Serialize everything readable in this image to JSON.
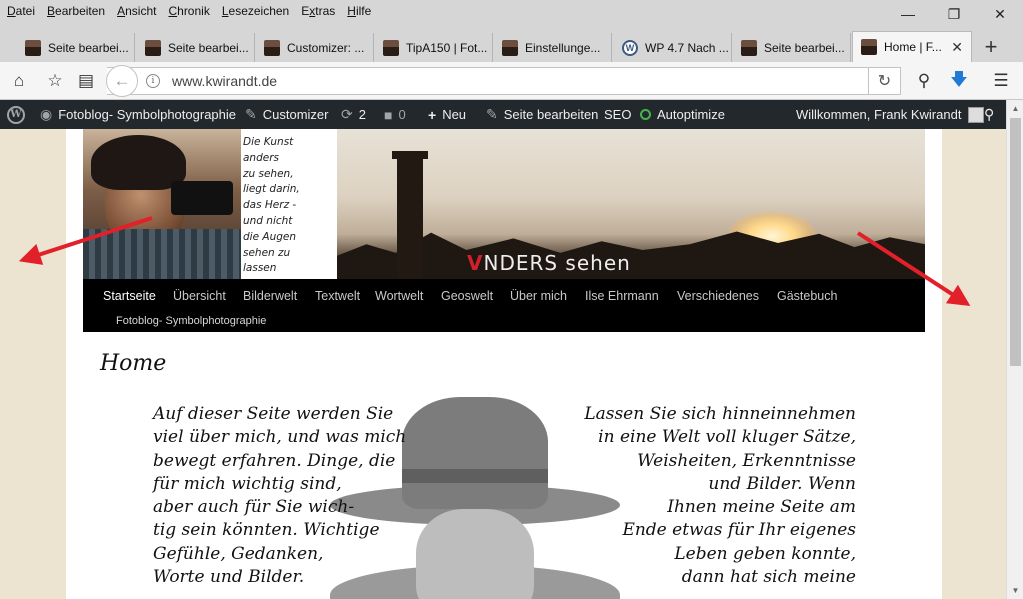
{
  "menubar": {
    "items": [
      {
        "pre": "",
        "key": "D",
        "post": "atei"
      },
      {
        "pre": "",
        "key": "B",
        "post": "earbeiten"
      },
      {
        "pre": "",
        "key": "A",
        "post": "nsicht"
      },
      {
        "pre": "",
        "key": "C",
        "post": "hronik"
      },
      {
        "pre": "",
        "key": "L",
        "post": "esezeichen"
      },
      {
        "pre": "E",
        "key": "x",
        "post": "tras"
      },
      {
        "pre": "",
        "key": "H",
        "post": "ilfe"
      }
    ]
  },
  "window": {
    "minimize_icon": "minimize-icon",
    "restore_icon": "restore-icon",
    "close_icon": "close-icon"
  },
  "tabs": [
    {
      "label": "Seite bearbei...",
      "favicon": "user-photo"
    },
    {
      "label": "Seite bearbei...",
      "favicon": "user-photo"
    },
    {
      "label": "Customizer: ...",
      "favicon": "user-photo"
    },
    {
      "label": "TipA150 | Fot...",
      "favicon": "user-photo"
    },
    {
      "label": "Einstellunge...",
      "favicon": "user-photo"
    },
    {
      "label": "WP 4.7 Nach ...",
      "favicon": "wordpress"
    },
    {
      "label": "Seite bearbei...",
      "favicon": "user-photo"
    },
    {
      "label": "Home | F...",
      "favicon": "user-photo",
      "active": true
    }
  ],
  "new_tab_label": "+",
  "navbar": {
    "url": "www.kwirandt.de",
    "info_glyph": "i"
  },
  "adminbar": {
    "site_name": "Fotoblog- Symbolphotographie",
    "customizer": "Customizer",
    "updates_count": "2",
    "comments_count": "0",
    "new_label": "Neu",
    "edit_page": "Seite bearbeiten",
    "seo": "SEO",
    "autoptimize": "Autoptimize",
    "greeting": "Willkommen, Frank Kwirandt"
  },
  "header": {
    "quote_lines": [
      "Die Kunst",
      "anders",
      "zu sehen,",
      "liegt darin,",
      "das Herz -",
      "und nicht",
      "die Augen",
      "sehen zu",
      "lassen"
    ],
    "brand_v": "V",
    "brand_rest": "NDERS sehen"
  },
  "nav": {
    "items": [
      "Startseite",
      "Übersicht",
      "Bilderwelt",
      "Textwelt",
      "Wortwelt",
      "Geoswelt",
      "Über mich",
      "Ilse Ehrmann",
      "Verschiedenes",
      "Gästebuch"
    ],
    "subtitle": "Fotoblog- Symbolphotographie"
  },
  "page_title": "Home",
  "poem_left": [
    "Auf dieser Seite werden Sie",
    "viel über mich, und was mich",
    "bewegt erfahren. Dinge, die",
    "für mich wichtig sind,",
    "aber auch für Sie wich-",
    "tig sein könnten. Wichtige",
    "Gefühle, Gedanken,",
    "Worte und Bilder."
  ],
  "poem_right": [
    "Lassen Sie sich hinneinnehmen",
    "in eine Welt voll kluger Sätze,",
    "Weisheiten, Erkenntnisse",
    "und Bilder. Wenn",
    "Ihnen meine Seite am",
    "Ende etwas für Ihr eigenes",
    "Leben geben konnte,",
    "dann hat sich meine"
  ],
  "colors": {
    "admin_bar": "#23282d",
    "page_bg": "#ede3d1",
    "arrow": "#e2202a",
    "brand_v": "#d1202a"
  }
}
